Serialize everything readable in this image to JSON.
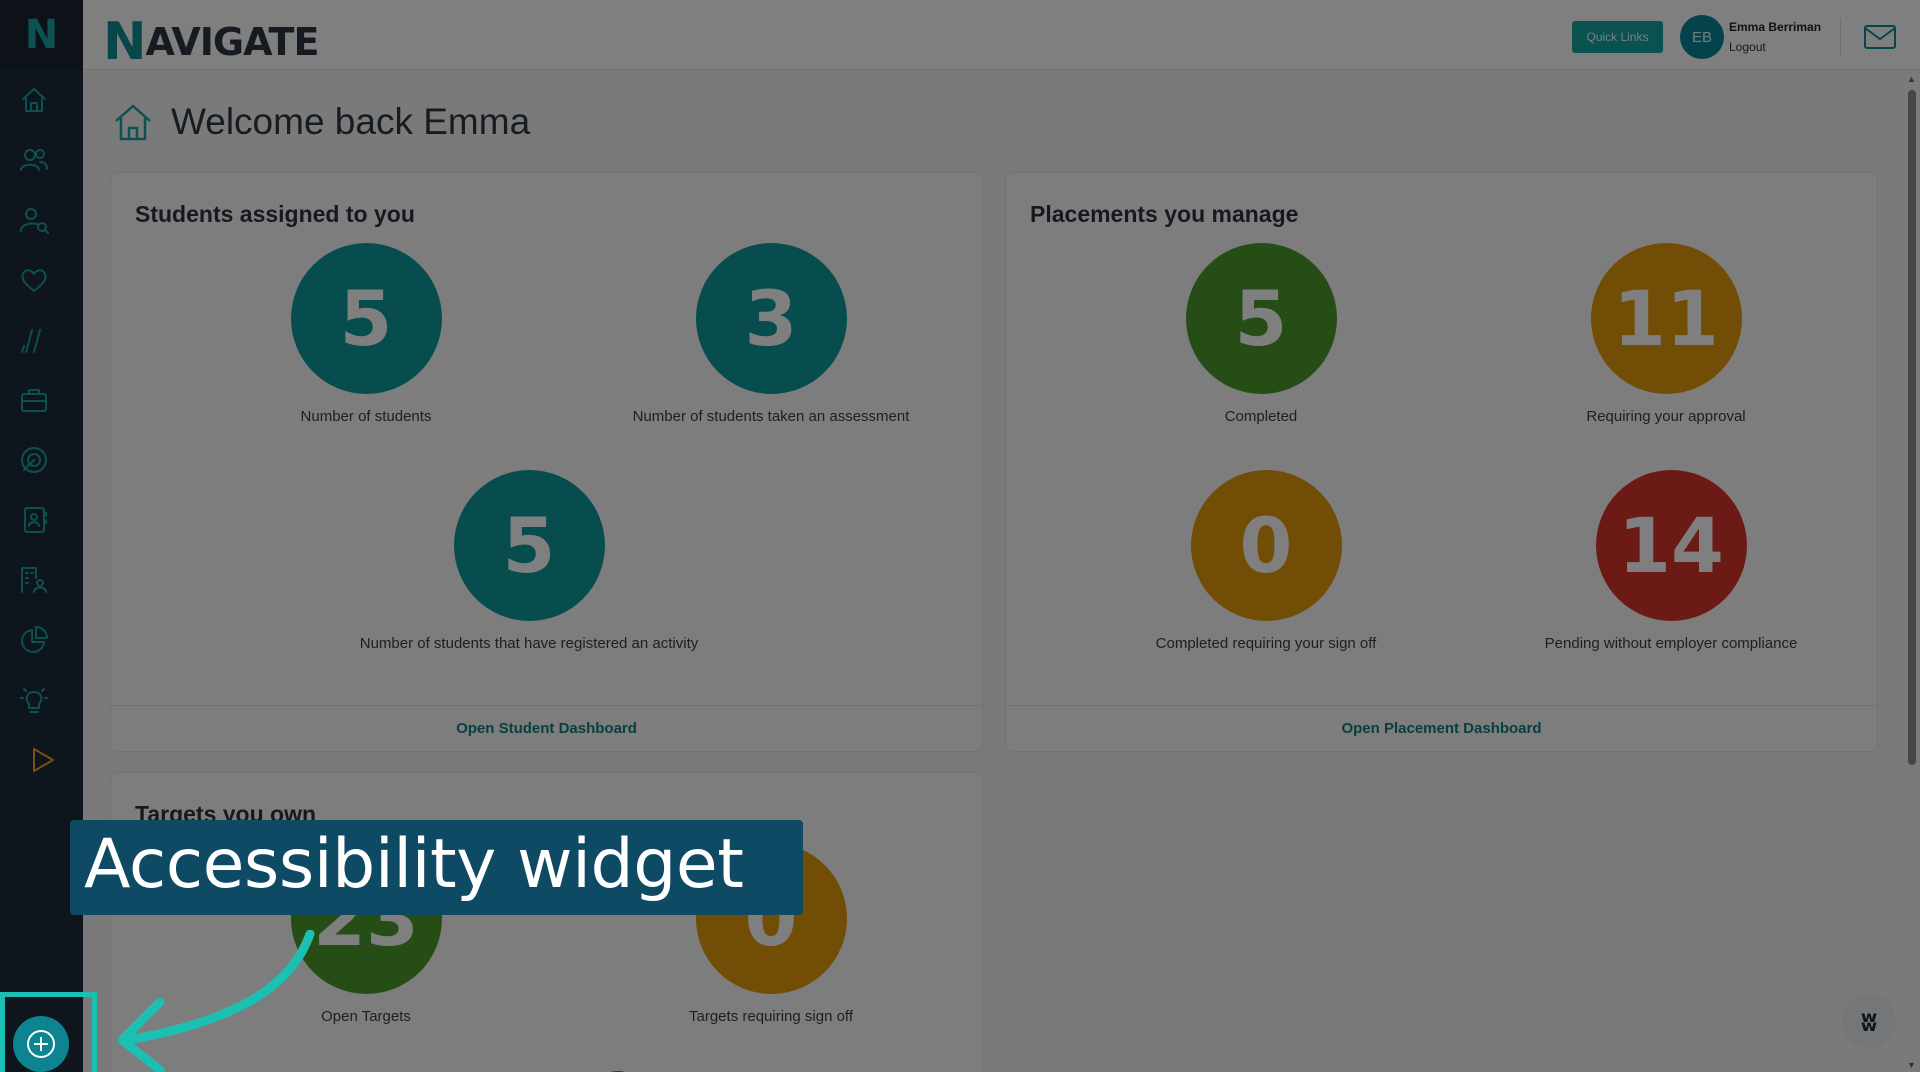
{
  "sidebar": {
    "logo_letter": "N",
    "items": [
      {
        "icon": "home-icon"
      },
      {
        "icon": "users-icon"
      },
      {
        "icon": "user-search-icon"
      },
      {
        "icon": "heart-icon"
      },
      {
        "icon": "lines-icon"
      },
      {
        "icon": "briefcase-icon"
      },
      {
        "icon": "target-icon"
      },
      {
        "icon": "contact-book-icon"
      },
      {
        "icon": "building-user-icon"
      },
      {
        "icon": "pie-chart-icon"
      },
      {
        "icon": "lightbulb-icon"
      },
      {
        "icon": "play-icon"
      }
    ]
  },
  "header": {
    "brand_first": "N",
    "brand_rest": "AVIGATE",
    "quick_links": "Quick Links",
    "user_initials": "EB",
    "user_name": "Emma Berriman",
    "logout": "Logout",
    "mail_icon": "mail-icon"
  },
  "main": {
    "welcome": "Welcome back Emma",
    "students_card": {
      "title": "Students assigned to you",
      "stats": [
        {
          "value": "5",
          "label": "Number of students",
          "color": "#0f9a9b"
        },
        {
          "value": "3",
          "label": "Number of students taken an assessment",
          "color": "#0f9a9b"
        },
        {
          "value": "5",
          "label": "Number of students that have registered an activity",
          "color": "#0f9a9b"
        }
      ],
      "footer": "Open Student Dashboard"
    },
    "placements_card": {
      "title": "Placements you manage",
      "stats": [
        {
          "value": "5",
          "label": "Completed",
          "color": "#4f9a2c"
        },
        {
          "value": "11",
          "label": "Requiring your approval",
          "color": "#e39a0c"
        },
        {
          "value": "0",
          "label": "Completed requiring your sign off",
          "color": "#e39a0c"
        },
        {
          "value": "14",
          "label": "Pending without employer compliance",
          "color": "#d8352a"
        }
      ],
      "footer": "Open Placement Dashboard"
    },
    "targets_card": {
      "title": "Targets you own",
      "stats": [
        {
          "value": "23",
          "label": "Open Targets",
          "color": "#4f9a2c"
        },
        {
          "value": "0",
          "label": "Targets requiring sign off",
          "color": "#e39a0c"
        }
      ]
    }
  },
  "callout": {
    "text": "Accessibility widget"
  },
  "colors": {
    "sidebar_bg": "#1f2b38",
    "accent": "#1aa3a6",
    "overlay": "rgba(0,0,0,0.5)",
    "callout_bg": "#0e4a63",
    "highlight": "#1bc0b2"
  }
}
